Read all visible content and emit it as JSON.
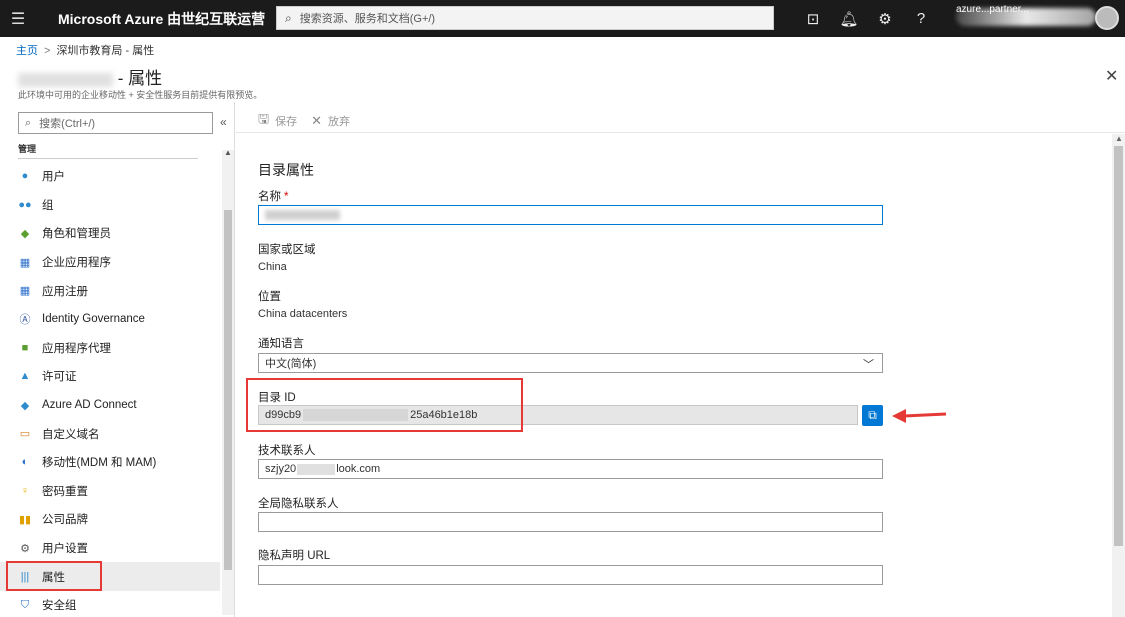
{
  "topbar": {
    "brand": "Microsoft Azure 由世纪互联运营",
    "search_placeholder": "搜索资源、服务和文档(G+/)",
    "icons": [
      "feedback-icon",
      "bell-icon",
      "gear-icon",
      "help-icon"
    ],
    "user_text": "azure...partner..."
  },
  "breadcrumb": {
    "home": "主页",
    "separator": ">",
    "current": "深圳市教育局 - 属性"
  },
  "page": {
    "title_suffix": "- 属性",
    "subtitle": "此环境中可用的企业移动性 + 安全性服务目前提供有限预览。"
  },
  "nav": {
    "search_placeholder": "搜索(Ctrl+/)",
    "collapse": "«",
    "group_label": "管理",
    "items": [
      {
        "label": "用户",
        "icon": "user-icon",
        "color": "#2e8bcc"
      },
      {
        "label": "组",
        "icon": "group-icon",
        "color": "#2e8bcc"
      },
      {
        "label": "角色和管理员",
        "icon": "roles-icon",
        "color": "#5a9e2f"
      },
      {
        "label": "企业应用程序",
        "icon": "apps-grid-icon",
        "color": "#2e6fcc"
      },
      {
        "label": "应用注册",
        "icon": "app-registration-icon",
        "color": "#2e6fcc"
      },
      {
        "label": "Identity Governance",
        "icon": "identity-governance-icon",
        "color": "#3a5fa8"
      },
      {
        "label": "应用程序代理",
        "icon": "app-proxy-icon",
        "color": "#5a9e2f"
      },
      {
        "label": "许可证",
        "icon": "license-icon",
        "color": "#2e8bcc"
      },
      {
        "label": "Azure AD Connect",
        "icon": "ad-connect-icon",
        "color": "#2e8bcc"
      },
      {
        "label": "自定义域名",
        "icon": "custom-domain-icon",
        "color": "#d9822b"
      },
      {
        "label": "移动性(MDM 和 MAM)",
        "icon": "mobility-icon",
        "color": "#2e6fcc"
      },
      {
        "label": "密码重置",
        "icon": "key-icon",
        "color": "#e0b400"
      },
      {
        "label": "公司品牌",
        "icon": "branding-icon",
        "color": "#e0a100"
      },
      {
        "label": "用户设置",
        "icon": "user-settings-icon",
        "color": "#555555"
      },
      {
        "label": "属性",
        "icon": "properties-icon",
        "color": "#2e8bcc"
      },
      {
        "label": "安全组",
        "icon": "shield-icon",
        "color": "#2e6fcc"
      }
    ]
  },
  "toolbar": {
    "save_label": "保存",
    "discard_label": "放弃"
  },
  "form": {
    "section_title": "目录属性",
    "name_label": "名称",
    "name_required": "*",
    "country_label": "国家或区域",
    "country_value": "China",
    "location_label": "位置",
    "location_value": "China datacenters",
    "language_label": "通知语言",
    "language_value": "中文(简体)",
    "directory_id_label": "目录 ID",
    "directory_id_prefix": "d99cb9",
    "directory_id_suffix": "25a46b1e18b",
    "tech_contact_label": "技术联系人",
    "tech_contact_prefix": "szjy20",
    "tech_contact_suffix": "look.com",
    "privacy_contact_label": "全局隐私联系人",
    "privacy_contact_value": "",
    "privacy_url_label": "隐私声明 URL",
    "privacy_url_value": ""
  },
  "colors": {
    "accent": "#0078d4",
    "highlight": "#e53935",
    "topbar": "#1b1b1b"
  }
}
